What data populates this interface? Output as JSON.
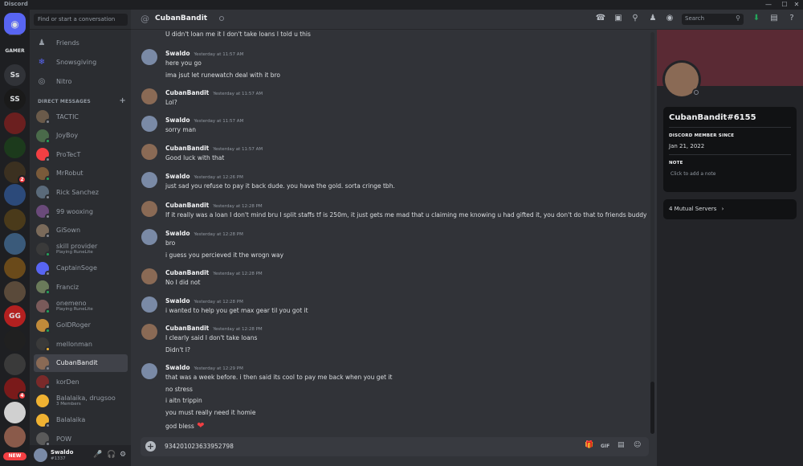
{
  "window": {
    "title": "Discord",
    "min": "—",
    "max": "☐",
    "close": "✕"
  },
  "rail": {
    "servers": [
      {
        "label": "",
        "icon": "discord-home-icon"
      },
      {
        "label": "GAMER",
        "color": "#1e1f22"
      },
      {
        "label": "Ss",
        "color": "#313338"
      },
      {
        "label": "SS",
        "color": "#1a1a1a"
      },
      {
        "label": "",
        "color": "#6b1f1f"
      },
      {
        "label": "",
        "color": "#1c3a1c"
      },
      {
        "label": "",
        "color": "#3b3020",
        "badge": "2"
      },
      {
        "label": "",
        "color": "#2c4a7a"
      },
      {
        "label": "",
        "color": "#4a3a1a"
      },
      {
        "label": "",
        "color": "#3a5a7a"
      },
      {
        "label": "",
        "color": "#6a4a1a"
      },
      {
        "label": "",
        "color": "#5a4a3a"
      },
      {
        "label": "GG",
        "color": "#b32020"
      },
      {
        "label": "",
        "color": "#202020"
      },
      {
        "label": "",
        "color": "#3a3a3a"
      },
      {
        "label": "",
        "color": "#7a1a1a",
        "badge": "4"
      },
      {
        "label": "",
        "color": "#d0d0d0"
      },
      {
        "label": "",
        "color": "#8a5a4a"
      }
    ],
    "new_label": "NEW"
  },
  "sidebar": {
    "search_placeholder": "Find or start a conversation",
    "nav": [
      {
        "label": "Friends",
        "icon": "friends-icon"
      },
      {
        "label": "Snowsgiving",
        "icon": "snowflake-icon"
      },
      {
        "label": "Nitro",
        "icon": "nitro-icon"
      }
    ],
    "dm_header": "DIRECT MESSAGES",
    "dm_add": "+",
    "dms": [
      {
        "name": "TACTIC",
        "color": "#6a5a4a",
        "status": "#80848e"
      },
      {
        "name": "JoyBoy",
        "color": "#4a6a4a",
        "status": "#23a55a"
      },
      {
        "name": "ProTecT",
        "color": "#f23f43",
        "status": "#80848e"
      },
      {
        "name": "MrRobut",
        "color": "#7a5a3a",
        "status": "#23a55a"
      },
      {
        "name": "Rick Sanchez",
        "color": "#5a6a7a",
        "status": "#80848e"
      },
      {
        "name": "99 wooxing",
        "color": "#6a4a7a",
        "status": "#80848e"
      },
      {
        "name": "GiSown",
        "color": "#7a6a5a",
        "status": "#80848e"
      },
      {
        "name": "skill provider",
        "sub": "Playing RuneLite",
        "color": "#3a3a3a",
        "status": "#23a55a"
      },
      {
        "name": "CaptainSoge",
        "color": "#5865f2",
        "status": "#80848e"
      },
      {
        "name": "Franciz",
        "color": "#6a7a5a",
        "status": "#23a55a"
      },
      {
        "name": "onemeno",
        "sub": "Playing RuneLite",
        "color": "#7a5a5a",
        "status": "#23a55a"
      },
      {
        "name": "GolDRoger",
        "color": "#c08a3a",
        "status": "#23a55a"
      },
      {
        "name": "mellonman",
        "color": "#3a3a3a",
        "status": "#f0b232"
      },
      {
        "name": "CubanBandit",
        "color": "#8a6a55",
        "status": "#80848e",
        "active": true
      },
      {
        "name": "korDen",
        "color": "#7a2a2a",
        "status": "#80848e"
      },
      {
        "name": "Balalaika, drugsoo",
        "sub": "3 Members",
        "color": "#f0b232",
        "status": ""
      },
      {
        "name": "Balalaika",
        "color": "#f0b232",
        "status": "#80848e"
      },
      {
        "name": "POW",
        "color": "#5a5a5a",
        "status": "#80848e"
      }
    ]
  },
  "user": {
    "name": "Swaldo",
    "tag": "#1337"
  },
  "channel": {
    "title": "CubanBandit",
    "search_placeholder": "Search"
  },
  "messages": [
    {
      "author": "",
      "time": "",
      "lines": [
        "U didn't loan me it I don't take loans I told u this"
      ],
      "y": 0,
      "partial": true
    },
    {
      "author": "Swaldo",
      "time": "Yesterday at 11:57 AM",
      "lines": [
        "here you go",
        "ima jsut let runewatch deal with it bro"
      ],
      "who": "s"
    },
    {
      "author": "CubanBandit",
      "time": "Yesterday at 11:57 AM",
      "lines": [
        "Lol?"
      ],
      "who": "c"
    },
    {
      "author": "Swaldo",
      "time": "Yesterday at 11:57 AM",
      "lines": [
        "sorry man"
      ],
      "who": "s"
    },
    {
      "author": "CubanBandit",
      "time": "Yesterday at 11:57 AM",
      "lines": [
        "Good luck with that"
      ],
      "who": "c"
    },
    {
      "author": "Swaldo",
      "time": "Yesterday at 12:26 PM",
      "lines": [
        "just sad you refuse to pay it back dude.  you have the gold. sorta cringe tbh."
      ],
      "who": "s"
    },
    {
      "author": "CubanBandit",
      "time": "Yesterday at 12:28 PM",
      "lines": [
        "If it really was a loan I don't mind bru I split staffs tf is 250m, it just gets me mad that u claiming me knowing u had gifted it, you don't do that to friends buddy"
      ],
      "who": "c"
    },
    {
      "author": "Swaldo",
      "time": "Yesterday at 12:28 PM",
      "lines": [
        "bro",
        "i guess you percieved it the wrogn way"
      ],
      "who": "s"
    },
    {
      "author": "CubanBandit",
      "time": "Yesterday at 12:28 PM",
      "lines": [
        "No I did not"
      ],
      "who": "c"
    },
    {
      "author": "Swaldo",
      "time": "Yesterday at 12:28 PM",
      "lines": [
        "i wanted to help you get max gear til you got it"
      ],
      "who": "s"
    },
    {
      "author": "CubanBandit",
      "time": "Yesterday at 12:28 PM",
      "lines": [
        "I clearly said I don't take loans",
        "Didn't I?"
      ],
      "who": "c"
    },
    {
      "author": "Swaldo",
      "time": "Yesterday at 12:29 PM",
      "lines": [
        "that was a week before.  i then said its cool to pay me back when you get it",
        "no stress",
        "i aitn trippin",
        "you must really need it homie",
        "god bless"
      ],
      "who": "s",
      "heart": true
    }
  ],
  "composer": {
    "value": "934201023633952798"
  },
  "profile": {
    "name": "CubanBandit#6155",
    "member_since_label": "DISCORD MEMBER SINCE",
    "member_since": "Jan 21, 2022",
    "note_label": "NOTE",
    "note_placeholder": "Click to add a note",
    "mutual": "4 Mutual Servers"
  },
  "colors": {
    "accent": "#5865f2",
    "online": "#23a55a",
    "idle": "#f0b232",
    "dnd": "#f23f43",
    "offline": "#80848e",
    "banner": "#5a2a34"
  }
}
